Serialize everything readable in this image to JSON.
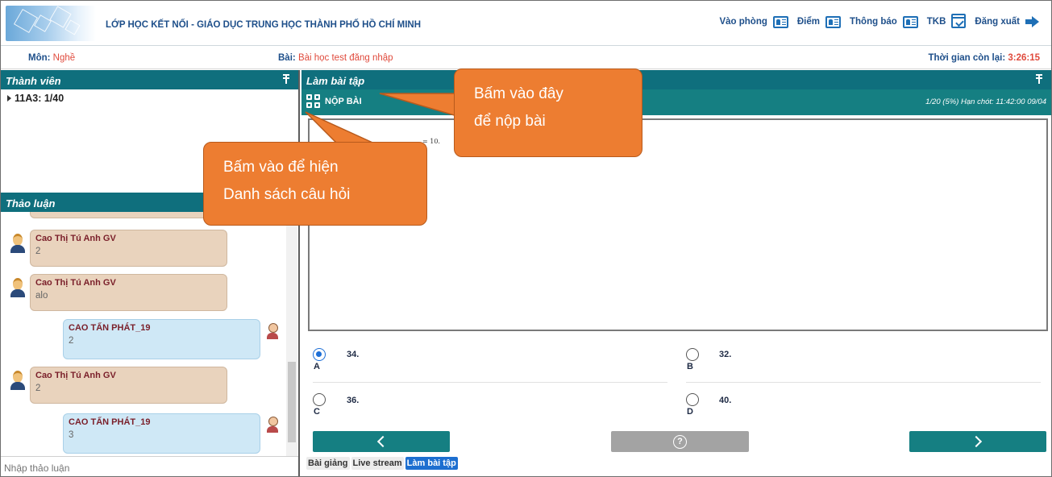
{
  "header": {
    "site_title": "LỚP HỌC KẾT NỐI -  GIÁO DỤC TRUNG HỌC THÀNH PHỐ HỒ CHÍ MINH",
    "nav": [
      {
        "label": "Vào phòng",
        "icon": "id-card-icon"
      },
      {
        "label": "Điểm",
        "icon": "id-card-icon"
      },
      {
        "label": "Thông báo",
        "icon": "id-card-icon"
      },
      {
        "label": "TKB",
        "icon": "calendar-check-icon"
      },
      {
        "label": "Đăng xuất",
        "icon": "logout-icon"
      }
    ]
  },
  "subheader": {
    "subject_label": "Môn:",
    "subject_value": "Nghề",
    "lesson_label": "Bài:",
    "lesson_value": "Bài học test đăng nhập",
    "time_label": "Thời gian còn lại:",
    "time_value": "3:26:15"
  },
  "members": {
    "title": "Thành viên",
    "items": [
      {
        "label": "11A3: 1/40"
      }
    ]
  },
  "discussion": {
    "title": "Thảo luận",
    "messages": [
      {
        "author": "Cao Thị Tú Anh GV",
        "text": "2",
        "role": "teacher"
      },
      {
        "author": "Cao Thị Tú Anh GV",
        "text": "alo",
        "role": "teacher"
      },
      {
        "author": "CAO TẤN PHÁT_19",
        "text": "2",
        "role": "student"
      },
      {
        "author": "Cao Thị Tú Anh GV",
        "text": "2",
        "role": "teacher"
      },
      {
        "author": "CAO TẤN PHÁT_19",
        "text": "3",
        "role": "student"
      }
    ],
    "input_placeholder": "Nhập thảo luận"
  },
  "exercise": {
    "title": "Làm bài tập",
    "submit_label": "NỘP BÀI",
    "progress_text": "1/20 (5%)   Hạn chót: 11:42:00 09/04",
    "question_snippet": "= 10.",
    "options": [
      {
        "letter": "A",
        "value": "34.",
        "checked": true
      },
      {
        "letter": "B",
        "value": "32.",
        "checked": false
      },
      {
        "letter": "C",
        "value": "36.",
        "checked": false
      },
      {
        "letter": "D",
        "value": "40.",
        "checked": false
      }
    ],
    "help_symbol": "?",
    "tabs": [
      {
        "label": "Bài giảng",
        "active": false
      },
      {
        "label": "Live stream",
        "active": false
      },
      {
        "label": "Làm bài tập",
        "active": true
      }
    ]
  },
  "callouts": {
    "submit": {
      "line1": "Bấm vào đây",
      "line2": "để nộp bài"
    },
    "question_list": {
      "line1": "Bấm vào để hiện",
      "line2": "Danh sách câu hỏi"
    }
  },
  "colors": {
    "teal": "#157f82",
    "callout_orange": "#ed7d31",
    "accent_blue": "#1e6fb6"
  }
}
